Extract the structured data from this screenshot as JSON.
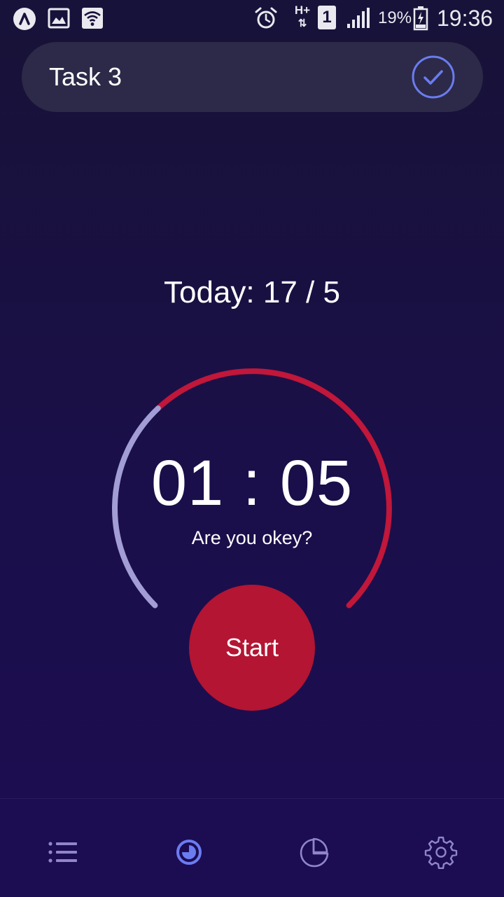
{
  "status_bar": {
    "battery_percent": "19%",
    "time": "19:36",
    "sim_slot": "1",
    "network_type": "H+",
    "icons": [
      "app-icon",
      "gallery-icon",
      "wifi-icon",
      "alarm-icon",
      "network-type-icon",
      "sim-icon",
      "signal-icon",
      "battery-icon"
    ]
  },
  "task": {
    "title": "Task 3",
    "check_icon": "check-circle-icon"
  },
  "today": {
    "label": "Today: 17 / 5"
  },
  "timer": {
    "display": "01 : 05",
    "message": "Are you okey?",
    "elapsed_fraction": 0.34,
    "colors": {
      "elapsed": "#a39dd6",
      "remaining": "#c0173a"
    }
  },
  "start_button": {
    "label": "Start",
    "color": "#b31533"
  },
  "bottom_nav": {
    "items": [
      {
        "name": "list",
        "icon": "list-icon",
        "active": false
      },
      {
        "name": "timer",
        "icon": "timer-icon",
        "active": true
      },
      {
        "name": "stats",
        "icon": "pie-chart-icon",
        "active": false
      },
      {
        "name": "settings",
        "icon": "gear-icon",
        "active": false
      }
    ],
    "active_color": "#6b7cf0",
    "inactive_color": "#8f86c9"
  }
}
